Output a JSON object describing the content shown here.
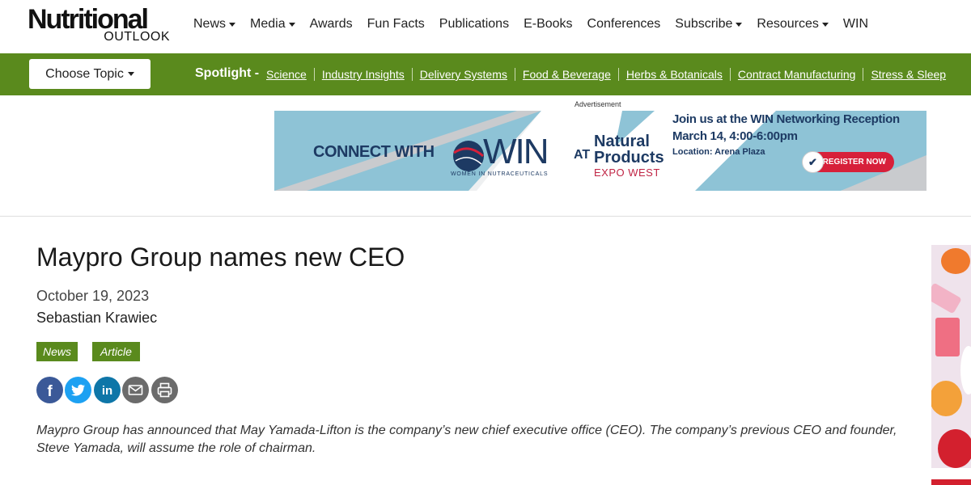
{
  "logo": {
    "line1": "Nutritional",
    "line2": "OUTLOOK"
  },
  "nav": {
    "items": [
      {
        "label": "News",
        "dropdown": true
      },
      {
        "label": "Media",
        "dropdown": true
      },
      {
        "label": "Awards",
        "dropdown": false
      },
      {
        "label": "Fun Facts",
        "dropdown": false
      },
      {
        "label": "Publications",
        "dropdown": false
      },
      {
        "label": "E-Books",
        "dropdown": false
      },
      {
        "label": "Conferences",
        "dropdown": false
      },
      {
        "label": "Subscribe",
        "dropdown": true
      },
      {
        "label": "Resources",
        "dropdown": true
      },
      {
        "label": "WIN",
        "dropdown": false
      }
    ]
  },
  "spotlight": {
    "choose_topic": "Choose Topic",
    "label": "Spotlight -",
    "links": [
      "Science",
      "Industry Insights",
      "Delivery Systems",
      "Food & Beverage",
      "Herbs & Botanicals",
      "Contract Manufacturing",
      "Stress & Sleep"
    ]
  },
  "ad": {
    "label": "Advertisement",
    "connect": "CONNECT WITH",
    "win": "WIN",
    "win_sub": "WOMEN IN NUTRACEUTICALS",
    "at": "AT",
    "natural": "Natural",
    "products": "Products",
    "expo": "EXPO WEST",
    "join": "Join us at the WIN Networking Reception",
    "date": "March 14, 4:00-6:00pm",
    "location": "Location: Arena Plaza",
    "register": "REGISTER NOW"
  },
  "article": {
    "title": "Maypro Group names new CEO",
    "date": "October 19, 2023",
    "author": "Sebastian Krawiec",
    "tags": [
      "News",
      "Article"
    ],
    "share": [
      "facebook-icon",
      "twitter-icon",
      "linkedin-icon",
      "email-icon",
      "print-icon"
    ],
    "lede": "Maypro Group has announced that May Yamada-Lifton is the company’s new chief executive office (CEO). The company’s previous CEO and founder, Steve Yamada, will assume the role of chairman."
  },
  "colors": {
    "brand_green": "#5a8a1d",
    "facebook": "#3b5998",
    "twitter": "#1da1f2",
    "linkedin": "#0e76a8",
    "gray_icon": "#6b6b6b"
  }
}
